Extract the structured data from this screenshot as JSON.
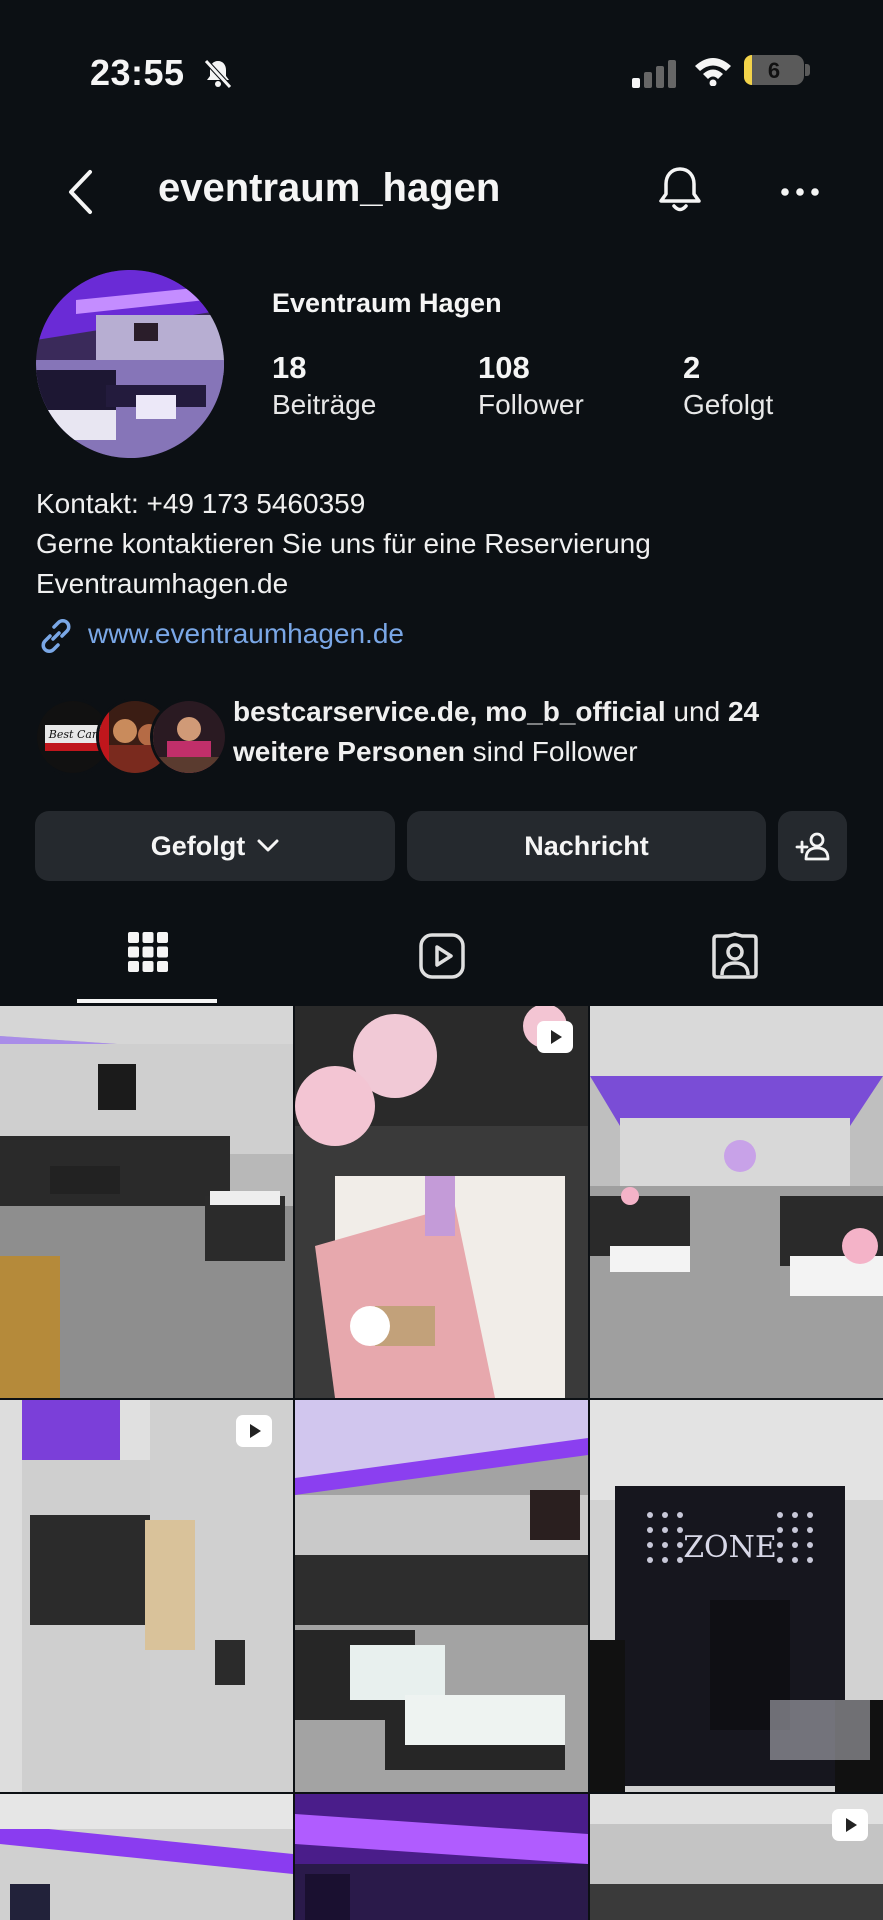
{
  "status_bar": {
    "time": "23:55",
    "battery_level": "6"
  },
  "header": {
    "username": "eventraum_hagen"
  },
  "profile": {
    "display_name": "Eventraum Hagen",
    "stats": [
      {
        "count": "18",
        "label": "Beiträge"
      },
      {
        "count": "108",
        "label": "Follower"
      },
      {
        "count": "2",
        "label": "Gefolgt"
      }
    ],
    "bio": [
      "Kontakt: +49 173 5460359",
      "Gerne kontaktieren Sie uns für eine Reservierung",
      "Eventraumhagen.de"
    ],
    "link": "www.eventraumhagen.de"
  },
  "followed_by": {
    "names": "bestcarservice.de, mo_b_official",
    "connector": " und ",
    "count_text": "24 weitere Personen",
    "suffix": " sind Follower",
    "avatar_1_text": "Best Car"
  },
  "actions": {
    "following_label": "Gefolgt",
    "message_label": "Nachricht"
  },
  "grid": {
    "posts": [
      {
        "type": "photo"
      },
      {
        "type": "reel"
      },
      {
        "type": "photo"
      },
      {
        "type": "reel"
      },
      {
        "type": "photo"
      },
      {
        "type": "photo",
        "sign_text": "ZONE"
      },
      {
        "type": "photo"
      },
      {
        "type": "photo"
      },
      {
        "type": "reel"
      }
    ]
  },
  "colors": {
    "background": "#0c1014",
    "button": "#25292e",
    "link": "#7aa7e6",
    "accent_purple": "#9b4dff"
  }
}
